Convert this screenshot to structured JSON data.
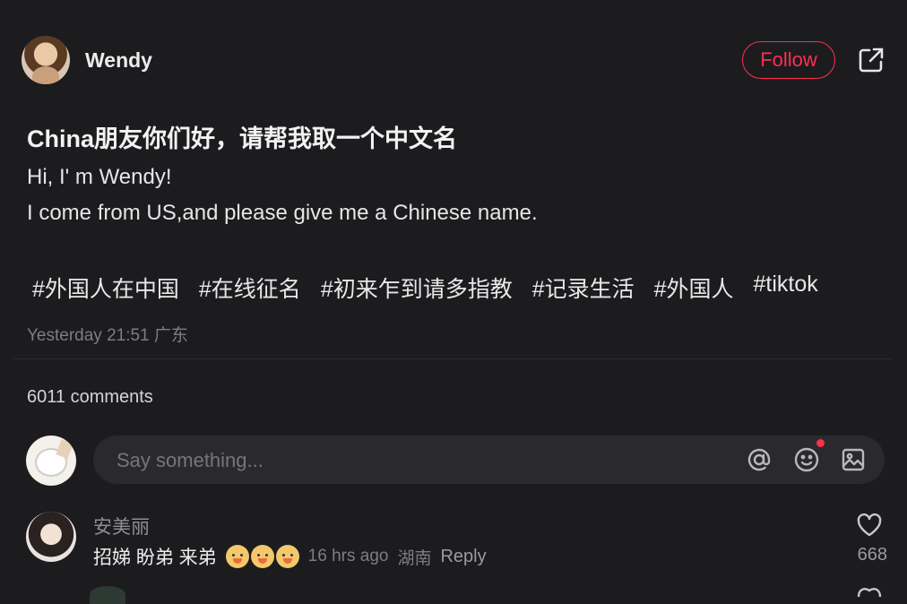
{
  "post": {
    "author": "Wendy",
    "follow_label": "Follow",
    "title": "China朋友你们好，请帮我取一个中文名",
    "body_lines": [
      "Hi, I' m Wendy!",
      "I come from US,and please give me a Chinese name."
    ],
    "tags": [
      "#外国人在中国",
      "#在线征名",
      "#初来乍到请多指教",
      "#记录生活",
      "#外国人",
      "#tiktok"
    ],
    "timestamp": "Yesterday 21:51",
    "location": "广东"
  },
  "comments_section": {
    "count_label": "6011 comments",
    "input_placeholder": "Say something..."
  },
  "comments": [
    {
      "author": "安美丽",
      "text": "招娣 盼弟 来弟",
      "time": "16 hrs ago",
      "location": "湖南",
      "reply_label": "Reply",
      "likes": "668"
    }
  ],
  "colors": {
    "accent": "#ff2e4d",
    "background": "#1c1c1f"
  },
  "icons": [
    "share-icon",
    "at-icon",
    "emoji-icon",
    "image-icon",
    "heart-icon"
  ]
}
